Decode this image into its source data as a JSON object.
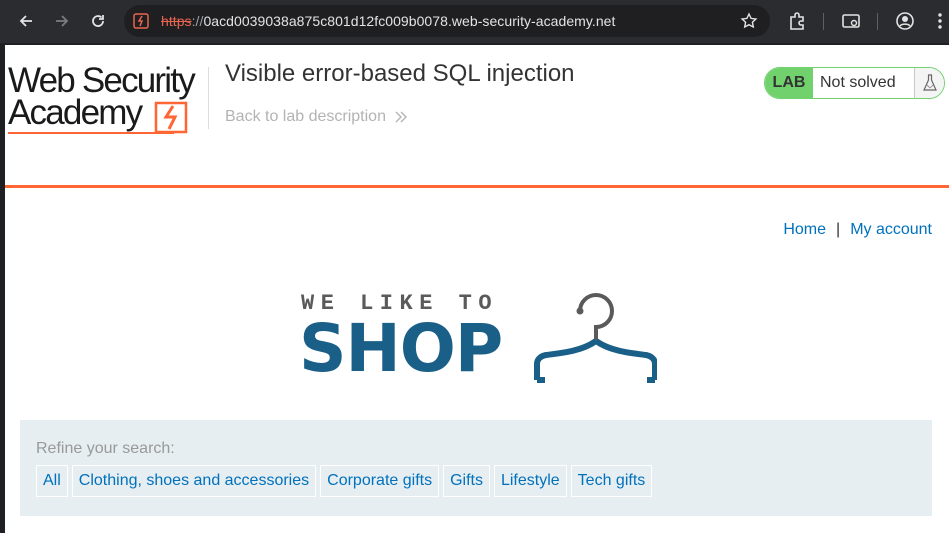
{
  "browser": {
    "url_scheme": "https",
    "url_separator": "://",
    "url_host": "0acd0039038a875c801d12fc009b0078.web-security-academy.net",
    "icons": [
      "back-icon",
      "forward-icon",
      "reload-icon",
      "site-info-icon",
      "bookmark-star-icon",
      "extensions-icon",
      "cast-icon",
      "profile-icon",
      "menu-icon"
    ]
  },
  "header": {
    "logo_line1": "Web Security",
    "logo_line2": "Academy",
    "title": "Visible error-based SQL injection",
    "back_link": "Back to lab description",
    "lab_tag": "LAB",
    "lab_status": "Not solved"
  },
  "nav": {
    "home": "Home",
    "separator": "|",
    "my_account": "My account"
  },
  "shop_logo": {
    "small": "WE LIKE TO",
    "big": "SHOP"
  },
  "search": {
    "label": "Refine your search:",
    "filters": [
      "All",
      "Clothing, shoes and accessories",
      "Corporate gifts",
      "Gifts",
      "Lifestyle",
      "Tech gifts"
    ]
  },
  "colors": {
    "accent_orange": "#ff6633",
    "lab_green": "#70d16d",
    "link_blue": "#0071bc",
    "shop_blue": "#1a5f87"
  }
}
